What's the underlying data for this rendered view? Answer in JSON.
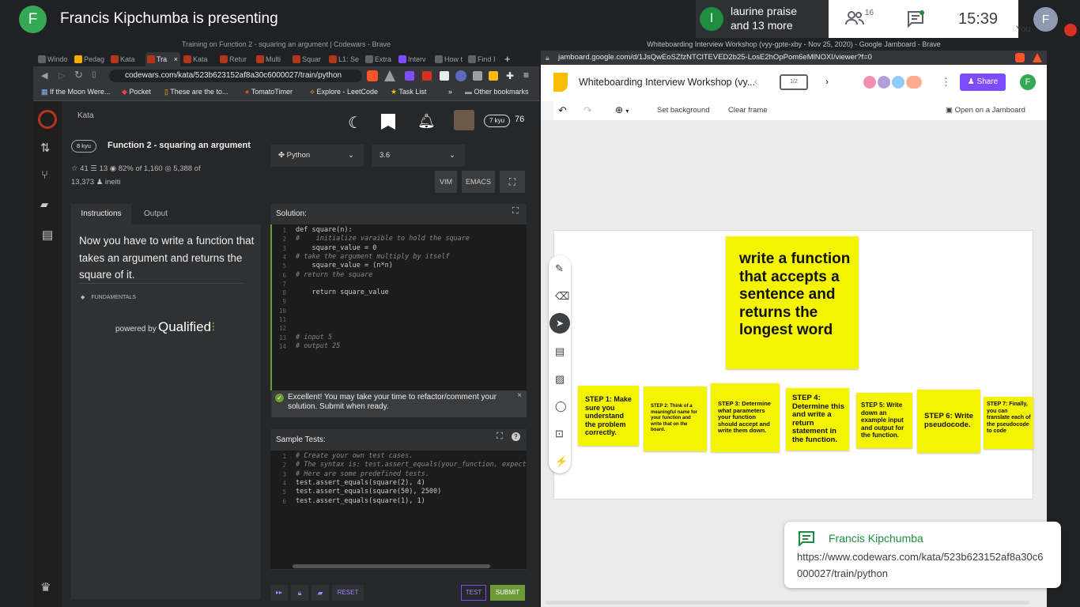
{
  "meet": {
    "presenter_initial": "F",
    "presenting_title": "Francis Kipchumba is presenting",
    "attendee_initial": "l",
    "attendee_name": "laurine praise",
    "attendee_more": "and 13 more",
    "people_count": "16",
    "time": "15:39",
    "you_initial": "F",
    "you_label": "You"
  },
  "left_browser": {
    "window_title": "Training on Function 2 - squaring an argument | Codewars - Brave",
    "tabs": [
      "Windo",
      "Pedag",
      "Kata",
      "Tra",
      "Kata",
      "Retur",
      "Multi",
      "Squar",
      "L1: Se",
      "Extra",
      "Interv",
      "How t",
      "Find I"
    ],
    "url": "codewars.com/kata/523b623152af8a30c6000027/train/python",
    "bookmarks": [
      "If the Moon Were...",
      "Pocket",
      "These are the to...",
      "TomatoTimer",
      "Explore - LeetCode",
      "Task List",
      "»",
      "Other bookmarks"
    ]
  },
  "codewars": {
    "header_label": "Kata",
    "rank_badge": "7 kyu",
    "honor": "76",
    "kata_rank": "8 kyu",
    "kata_title": "Function 2 - squaring an argument",
    "stars": "41",
    "collections": "13",
    "satisfaction": "82% of 1,160",
    "completed_a": "5,388 of",
    "completed_b": "13,373",
    "author": "ineiti",
    "language": "Python",
    "version": "3.6",
    "vim": "VIM",
    "emacs": "EMACS",
    "tab_instructions": "Instructions",
    "tab_output": "Output",
    "description": "Now you have to write a function that takes an argument and returns the square of it.",
    "tag": "FUNDAMENTALS",
    "powered_by": "powered by",
    "qualified": "Qualified",
    "solution_label": "Solution:",
    "success_msg": "Excellent! You may take your time to refactor/comment your solution. Submit when ready.",
    "sample_tests_label": "Sample Tests:",
    "reset": "RESET",
    "test": "TEST",
    "submit": "SUBMIT"
  },
  "solution_code": [
    "def square(n):",
    "#    initialize varaible to hold the square",
    "    square_value = 0",
    "# take the argument multiply by itself",
    "    square_value = (n*n)",
    "# return the square",
    "",
    "    return square_value",
    "",
    "",
    "",
    "",
    "# input 5",
    "# output 25"
  ],
  "test_code": [
    "# Create your own test cases.",
    "# The syntax is: test.assert_equals(your_function, expect",
    "# Here are some predefined tests.",
    "test.assert_equals(square(2), 4)",
    "test.assert_equals(square(50), 2500)",
    "test.assert_equals(square(1), 1)"
  ],
  "right_browser": {
    "window_title": "Whiteboarding Interview Workshop (vyy-gpte-xby - Nov 25, 2020) - Google Jamboard - Brave",
    "url": "jamboard.google.com/d/1JsQwEoSZfzNTClTEVED2b25-LosE2hOpPom6eMlNOXI/viewer?f=0",
    "doc_title": "Whiteboarding Interview Workshop (vy...",
    "frame_counter": "1/2",
    "share": "Share",
    "user_initial": "F",
    "set_background": "Set background",
    "clear_frame": "Clear frame",
    "open_on_jamboard": "Open on a Jamboard",
    "main_note": "write a function that accepts a sentence and returns the longest word",
    "steps": [
      "STEP 1: Make sure you understand the problem correctly.",
      "STEP 2: Think of a meaningful name for your function and write that on the board.",
      "STEP 3: Determine what parameters your function should accept and write them down.",
      "STEP 4: Determine this and write a return statement in the function.",
      "STEP 5: Write down an example input and output for the function.",
      "STEP 6: Write pseudocode.",
      "STEP 7: Finally, you can translate each of the pseudocode to code"
    ]
  },
  "chat_toast": {
    "name": "Francis Kipchumba",
    "message": "https://www.codewars.com/kata/523b623152af8a30c6000027/train/python"
  },
  "colors": {
    "meet_bg": "#202124",
    "codewars_red": "#b1361e",
    "submit_green": "#6b9a36",
    "sticky_yellow": "#f4f400",
    "share_purple": "#7c4dff",
    "toast_green": "#1e8e3e"
  }
}
